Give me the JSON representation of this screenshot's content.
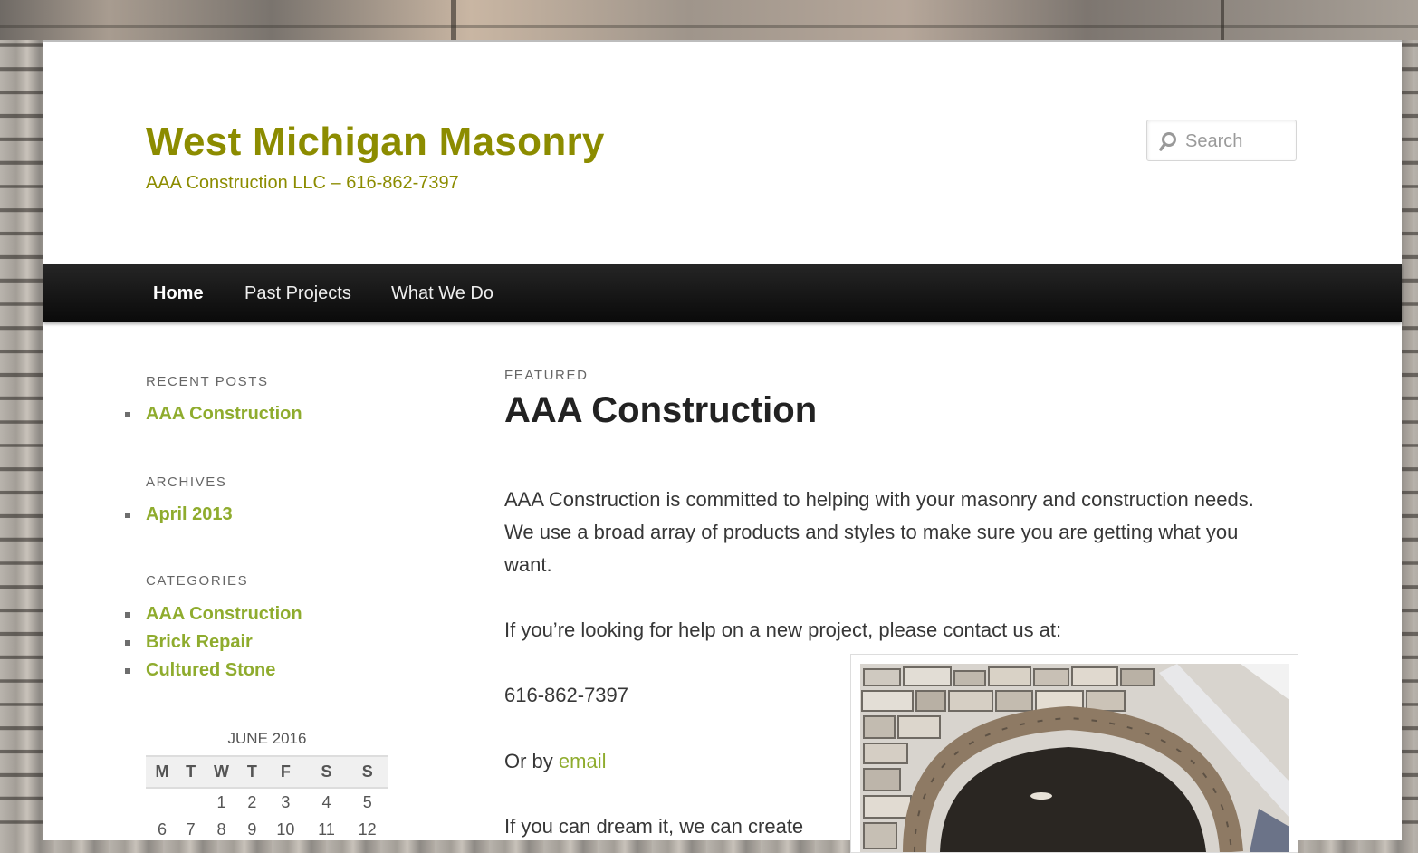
{
  "site": {
    "title": "West Michigan Masonry",
    "description": "AAA Construction LLC – 616-862-7397",
    "title_color": "#8c8c00"
  },
  "search": {
    "placeholder": "Search",
    "icon": "search-icon"
  },
  "nav": {
    "items": [
      {
        "label": "Home",
        "active": true
      },
      {
        "label": "Past Projects",
        "active": false
      },
      {
        "label": "What We Do",
        "active": false
      }
    ]
  },
  "sidebar": {
    "recent_posts": {
      "title": "RECENT POSTS",
      "items": [
        "AAA Construction"
      ]
    },
    "archives": {
      "title": "ARCHIVES",
      "items": [
        "April 2013"
      ]
    },
    "categories": {
      "title": "CATEGORIES",
      "items": [
        "AAA Construction",
        "Brick Repair",
        "Cultured Stone"
      ]
    },
    "calendar": {
      "caption": "JUNE 2016",
      "days": [
        "M",
        "T",
        "W",
        "T",
        "F",
        "S",
        "S"
      ],
      "rows": [
        [
          "",
          "",
          "1",
          "2",
          "3",
          "4",
          "5"
        ],
        [
          "6",
          "7",
          "8",
          "9",
          "10",
          "11",
          "12"
        ]
      ]
    },
    "link_color": "#8fac2e"
  },
  "post": {
    "featured_label": "FEATURED",
    "title": "AAA Construction",
    "p1_line1": "AAA Construction is committed to helping with your masonry and construction needs.",
    "p1_line2": "We use a broad array of products and styles to make sure you are getting what you",
    "p1_line3": "want.",
    "p2": "If you’re looking for help on a new project, please contact us at:",
    "phone": "616-862-7397",
    "email_prefix": "Or by ",
    "email_link": "email",
    "p4": "If you can dream it, we can create",
    "image": "stone-arch-photo"
  }
}
